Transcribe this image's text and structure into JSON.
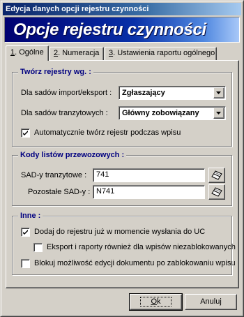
{
  "window": {
    "title": "Edycja danych opcji rejestru czynności"
  },
  "banner": {
    "title": "Opcje rejestru czynności"
  },
  "tabs": [
    {
      "num": "1",
      "label": ". Ogólne",
      "active": true
    },
    {
      "num": "2",
      "label": ". Numeracja",
      "active": false
    },
    {
      "num": "3",
      "label": ". Ustawienia raportu ogólnego",
      "active": false
    }
  ],
  "group1": {
    "title": "Twórz rejestry wg. :",
    "import_label": "Dla sadów import/eksport :",
    "import_value": "Zgłaszający",
    "transit_label": "Dla sadów tranzytowych :",
    "transit_value": "Główny zobowiązany",
    "auto_label": "Automatycznie twórz rejestr podczas wpisu",
    "auto_checked": true
  },
  "group2": {
    "title": "Kody listów przewozowych :",
    "sad_transit_label": "SAD-y tranzytowe :",
    "sad_transit_value": "741",
    "sad_other_label": "Pozostałe SAD-y :",
    "sad_other_value": "N741",
    "icon": "eraser-icon"
  },
  "group3": {
    "title": "Inne :",
    "opt1_label": "Dodaj do rejestru już w momencie wysłania do UC",
    "opt1_checked": true,
    "opt2_label": "Eksport i raporty również dla wpisów niezablokowanych",
    "opt2_checked": false,
    "opt3_label": "Blokuj możliwość edycji dokumentu po zablokowaniu wpisu",
    "opt3_checked": false
  },
  "buttons": {
    "ok_accel": "O",
    "ok_rest": "k",
    "cancel": "Anuluj"
  }
}
